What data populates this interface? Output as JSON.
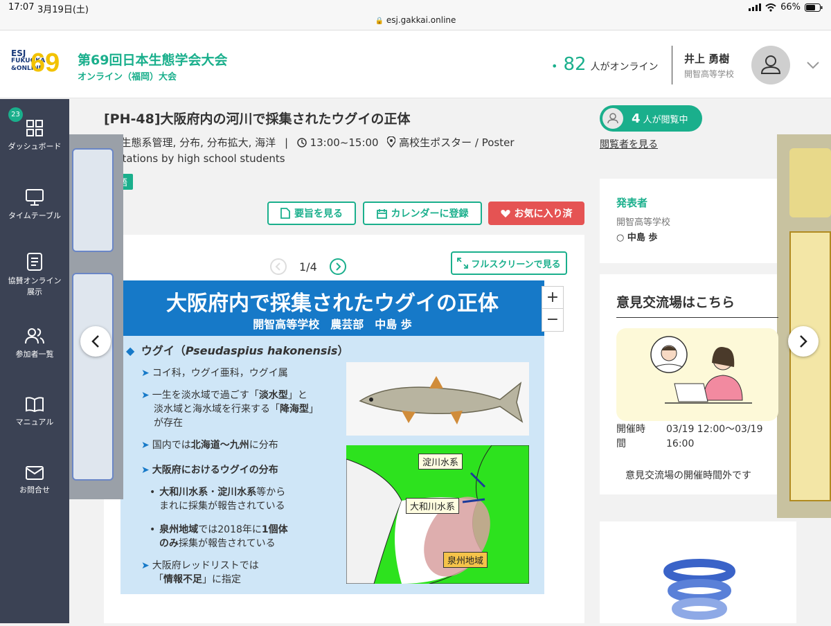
{
  "status_bar": {
    "time": "17:07",
    "date": "3月19日(土)",
    "battery": "66%"
  },
  "address_bar": {
    "url": "esj.gakkai.online"
  },
  "header": {
    "logo": {
      "line1": "ESJ",
      "line2": "FUKUOKA",
      "line3": "&ONLINE",
      "number": "69"
    },
    "conference_title": "第69回日本生態学会大会",
    "conference_subtitle": "オンライン（福岡）大会",
    "online_count": "82",
    "online_label": "人がオンライン",
    "user_name": "井上 勇樹",
    "user_org": "開智高等学校"
  },
  "sidebar": {
    "badge": "23",
    "items": [
      {
        "label": "ダッシュボード"
      },
      {
        "label": "タイムテーブル"
      },
      {
        "label": "協賛オンライン展示"
      },
      {
        "label": "参加者一覧"
      },
      {
        "label": "マニュアル"
      },
      {
        "label": "お問合せ"
      }
    ]
  },
  "poster": {
    "title": "[PH-48]大阪府内の河川で採集されたウグイの正体",
    "keywords": "生, 生態系管理, 分布, 分布拡大, 海洋",
    "time": "13:00~15:00",
    "session_line1": "高校生ポスター / Poster",
    "session_line2": "sentations by high school students",
    "language": "本語",
    "buttons": {
      "abstract": "要旨を見る",
      "calendar": "カレンダーに登録",
      "favorite": "お気に入り済"
    },
    "pager": "1/4",
    "fullscreen": "フルスクリーンで見る"
  },
  "viewers": {
    "count": "4",
    "label": "人が閲覧中",
    "link": "閲覧者を見る"
  },
  "slide": {
    "title": "大阪府内で採集されたウグイの正体",
    "author": "開智高等学校　農芸部　中島 歩",
    "heading_jp": "ウグイ（",
    "heading_latin": "Pseudaspius hakonensis",
    "heading_close": "）",
    "b1": "コイ科，ウグイ亜科，ウグイ属",
    "b2_a": "一生を淡水域で過ごす「",
    "b2_b": "淡水型",
    "b2_c": "」と",
    "b2_d": "淡水域と海水域を行来する「",
    "b2_e": "降海型",
    "b2_f": "」",
    "b2_g": "が存在",
    "b3_a": "国内では",
    "b3_b": "北海道〜九州",
    "b3_c": "に分布",
    "b4": "大阪府におけるウグイの分布",
    "b5_a": "大和川水系",
    "b5_b": "・",
    "b5_c": "淀川水系",
    "b5_d": "等から",
    "b5_e": "まれに採集が報告されている",
    "b6_a": "泉州地域",
    "b6_b": "では2018年に",
    "b6_c": "1個体",
    "b6_d": "のみ",
    "b6_e": "採集が報告されている",
    "b7_a": "大阪府レッドリストでは",
    "b7_b": "「",
    "b7_c": "情報不足",
    "b7_d": "」に指定",
    "map_labels": {
      "yodo": "淀川水系",
      "yamato": "大和川水系",
      "senshu": "泉州地域"
    },
    "zoom_in": "+",
    "zoom_out": "−"
  },
  "presenter": {
    "heading": "発表者",
    "org": "開智高等学校",
    "name": "○ 中島 歩"
  },
  "exchange": {
    "heading": "意見交流場はこちら",
    "time_label1": "開催時",
    "time_label2": "間",
    "time_value1": "03/19 12:00〜03/19",
    "time_value2": "16:00",
    "closed": "意見交流場の開催時間外です"
  },
  "colors": {
    "accent": "#1aaf8c",
    "sidebar": "#3b4254",
    "favorite": "#e55353",
    "slide_blue": "#1679c8"
  }
}
